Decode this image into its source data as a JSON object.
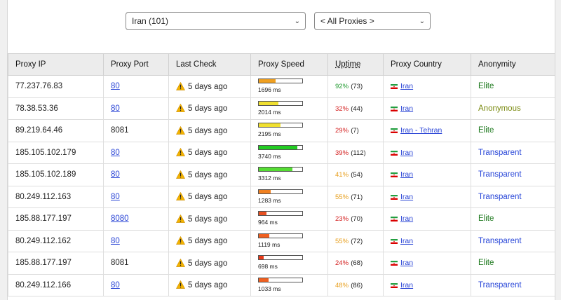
{
  "filters": {
    "country_select": "Iran (101)",
    "type_select": "< All Proxies >"
  },
  "columns": [
    "Proxy IP",
    "Proxy Port",
    "Last Check",
    "Proxy Speed",
    "Uptime",
    "Proxy Country",
    "Anonymity"
  ],
  "colors": {
    "speed_good": "#22cc22",
    "speed_medium": "#f0e030",
    "speed_slow_orange": "#f08020",
    "speed_slow_red": "#e83a1a",
    "uptime_green": "#1f9a2e",
    "uptime_red": "#d42020",
    "uptime_orange": "#e8a020",
    "anon_elite": "#1f7a1f",
    "anon_anonymous": "#7a8a10",
    "anon_transparent": "#2846d8"
  },
  "rows": [
    {
      "ip": "77.237.76.83",
      "port": "80",
      "port_link": true,
      "last_check": "5 days ago",
      "speed_fill": 0.38,
      "speed_color": "#f0a020",
      "speed_text": "1696 ms",
      "uptime_pct": "92%",
      "uptime_color": "#1f9a2e",
      "uptime_count": "(73)",
      "country": "Iran",
      "anonymity": "Elite",
      "anon_color": "#1f7a1f"
    },
    {
      "ip": "78.38.53.36",
      "port": "80",
      "port_link": true,
      "last_check": "5 days ago",
      "speed_fill": 0.45,
      "speed_color": "#f0e030",
      "speed_text": "2014 ms",
      "uptime_pct": "32%",
      "uptime_color": "#d42020",
      "uptime_count": "(44)",
      "country": "Iran",
      "anonymity": "Anonymous",
      "anon_color": "#7a8a10"
    },
    {
      "ip": "89.219.64.46",
      "port": "8081",
      "port_link": false,
      "last_check": "5 days ago",
      "speed_fill": 0.5,
      "speed_color": "#f0e030",
      "speed_text": "2195 ms",
      "uptime_pct": "29%",
      "uptime_color": "#d42020",
      "uptime_count": "(7)",
      "country": "Iran - Tehran",
      "anonymity": "Elite",
      "anon_color": "#1f7a1f"
    },
    {
      "ip": "185.105.102.179",
      "port": "80",
      "port_link": true,
      "last_check": "5 days ago",
      "speed_fill": 0.88,
      "speed_color": "#22cc22",
      "speed_text": "3740 ms",
      "uptime_pct": "39%",
      "uptime_color": "#d42020",
      "uptime_count": "(112)",
      "country": "Iran",
      "anonymity": "Transparent",
      "anon_color": "#2846d8"
    },
    {
      "ip": "185.105.102.189",
      "port": "80",
      "port_link": true,
      "last_check": "5 days ago",
      "speed_fill": 0.78,
      "speed_color": "#55dd33",
      "speed_text": "3312 ms",
      "uptime_pct": "41%",
      "uptime_color": "#e8a020",
      "uptime_count": "(54)",
      "country": "Iran",
      "anonymity": "Transparent",
      "anon_color": "#2846d8"
    },
    {
      "ip": "80.249.112.163",
      "port": "80",
      "port_link": true,
      "last_check": "5 days ago",
      "speed_fill": 0.27,
      "speed_color": "#f08020",
      "speed_text": "1283 ms",
      "uptime_pct": "55%",
      "uptime_color": "#e8a020",
      "uptime_count": "(71)",
      "country": "Iran",
      "anonymity": "Transparent",
      "anon_color": "#2846d8"
    },
    {
      "ip": "185.88.177.197",
      "port": "8080",
      "port_link": true,
      "last_check": "5 days ago",
      "speed_fill": 0.18,
      "speed_color": "#e85020",
      "speed_text": "964 ms",
      "uptime_pct": "23%",
      "uptime_color": "#d42020",
      "uptime_count": "(70)",
      "country": "Iran",
      "anonymity": "Elite",
      "anon_color": "#1f7a1f"
    },
    {
      "ip": "80.249.112.162",
      "port": "80",
      "port_link": true,
      "last_check": "5 days ago",
      "speed_fill": 0.24,
      "speed_color": "#f06020",
      "speed_text": "1119 ms",
      "uptime_pct": "55%",
      "uptime_color": "#e8a020",
      "uptime_count": "(72)",
      "country": "Iran",
      "anonymity": "Transparent",
      "anon_color": "#2846d8"
    },
    {
      "ip": "185.88.177.197",
      "port": "8081",
      "port_link": false,
      "last_check": "5 days ago",
      "speed_fill": 0.12,
      "speed_color": "#e83a1a",
      "speed_text": "698 ms",
      "uptime_pct": "24%",
      "uptime_color": "#d42020",
      "uptime_count": "(68)",
      "country": "Iran",
      "anonymity": "Elite",
      "anon_color": "#1f7a1f"
    },
    {
      "ip": "80.249.112.166",
      "port": "80",
      "port_link": true,
      "last_check": "5 days ago",
      "speed_fill": 0.22,
      "speed_color": "#f06020",
      "speed_text": "1033 ms",
      "uptime_pct": "48%",
      "uptime_color": "#e8a020",
      "uptime_count": "(86)",
      "country": "Iran",
      "anonymity": "Transparent",
      "anon_color": "#2846d8"
    }
  ]
}
